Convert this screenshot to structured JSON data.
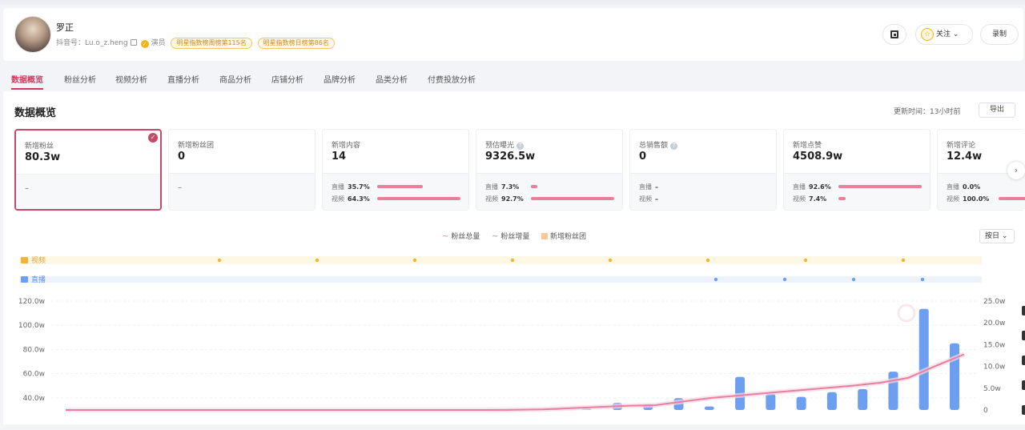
{
  "profile": {
    "name": "罗正",
    "douyin_label": "抖音号：",
    "douyin_id": "Lu.o_z.heng",
    "role": "演员",
    "badges": [
      "明星指数榜周榜第115名",
      "明星指数榜日榜第86名"
    ]
  },
  "actions": {
    "follow": "关注",
    "record": "录制",
    "icons": [
      "qrcode-icon",
      "star-icon",
      "chevron-down-icon"
    ]
  },
  "tabs": [
    "数据概览",
    "粉丝分析",
    "视频分析",
    "直播分析",
    "商品分析",
    "店铺分析",
    "品牌分析",
    "品类分析",
    "付费投放分析"
  ],
  "overview": {
    "title": "数据概览",
    "updated_label": "更新时间：",
    "updated_value": "13小时前",
    "export": "导出",
    "by_day": "按日"
  },
  "cards": [
    {
      "label": "新增粉丝",
      "value": "80.3w",
      "bottom": "–"
    },
    {
      "label": "新增粉丝团",
      "value": "0",
      "bottom": "–"
    },
    {
      "label": "新增内容",
      "value": "14",
      "live_label": "直播",
      "live_pct": "35.7%",
      "video_label": "视频",
      "video_pct": "64.3%"
    },
    {
      "label": "预估曝光",
      "value": "9326.5w",
      "live_label": "直播",
      "live_pct": "7.3%",
      "video_label": "视频",
      "video_pct": "92.7%"
    },
    {
      "label": "总销售额",
      "value": "0",
      "live_label": "直播",
      "live_pct": "–",
      "video_label": "视频",
      "video_pct": "–"
    },
    {
      "label": "新增点赞",
      "value": "4508.9w",
      "live_label": "直播",
      "live_pct": "92.6%",
      "video_label": "视频",
      "video_pct": "7.4%"
    },
    {
      "label": "新增评论",
      "value": "12.4w",
      "live_label": "直播",
      "live_pct": "0.0%",
      "video_label": "视频",
      "video_pct": "100.0%"
    }
  ],
  "legend": {
    "total": "粉丝总量",
    "increment": "粉丝增量",
    "fan_group": "新增粉丝团"
  },
  "lanes": {
    "video": "视频",
    "live": "直播"
  },
  "colors": {
    "accent": "#d23a5b",
    "bar": "#6c9ff0",
    "line": "#e87fa0",
    "video_lane": "#fdf7e5",
    "live_lane": "#eef3fb"
  },
  "chart_data": {
    "type": "bar",
    "left_axis": {
      "ticks": [
        "120.0w",
        "100.0w",
        "80.0w",
        "60.0w",
        "40.0w"
      ],
      "range": [
        30,
        120
      ]
    },
    "right_axis": {
      "ticks": [
        "25.0w",
        "20.0w",
        "15.0w",
        "10.0w",
        "5.0w",
        "0"
      ],
      "range": [
        0,
        25
      ]
    },
    "series": [
      {
        "name": "粉丝总量",
        "type": "line",
        "axis": "left",
        "values": [
          30,
          30,
          30,
          30,
          30,
          30,
          30,
          30,
          30,
          30,
          30,
          30,
          30,
          30,
          30,
          30,
          30.1,
          30.5,
          31.5,
          32.5,
          33.5,
          34,
          37,
          40,
          42,
          44,
          46,
          48,
          50,
          52.5,
          56.5,
          66.5,
          76
        ]
      },
      {
        "name": "粉丝增量",
        "type": "bar",
        "axis": "right",
        "values": [
          0,
          0,
          0,
          0,
          0,
          0,
          0,
          0,
          0,
          0,
          0,
          0,
          0,
          0,
          0,
          0,
          0.1,
          0.3,
          1.6,
          1.3,
          2.7,
          0.8,
          7.6,
          3.7,
          3.0,
          4.1,
          4.8,
          8.8,
          23.2,
          15.3
        ]
      }
    ],
    "video_markers": 8,
    "live_markers": 4
  }
}
